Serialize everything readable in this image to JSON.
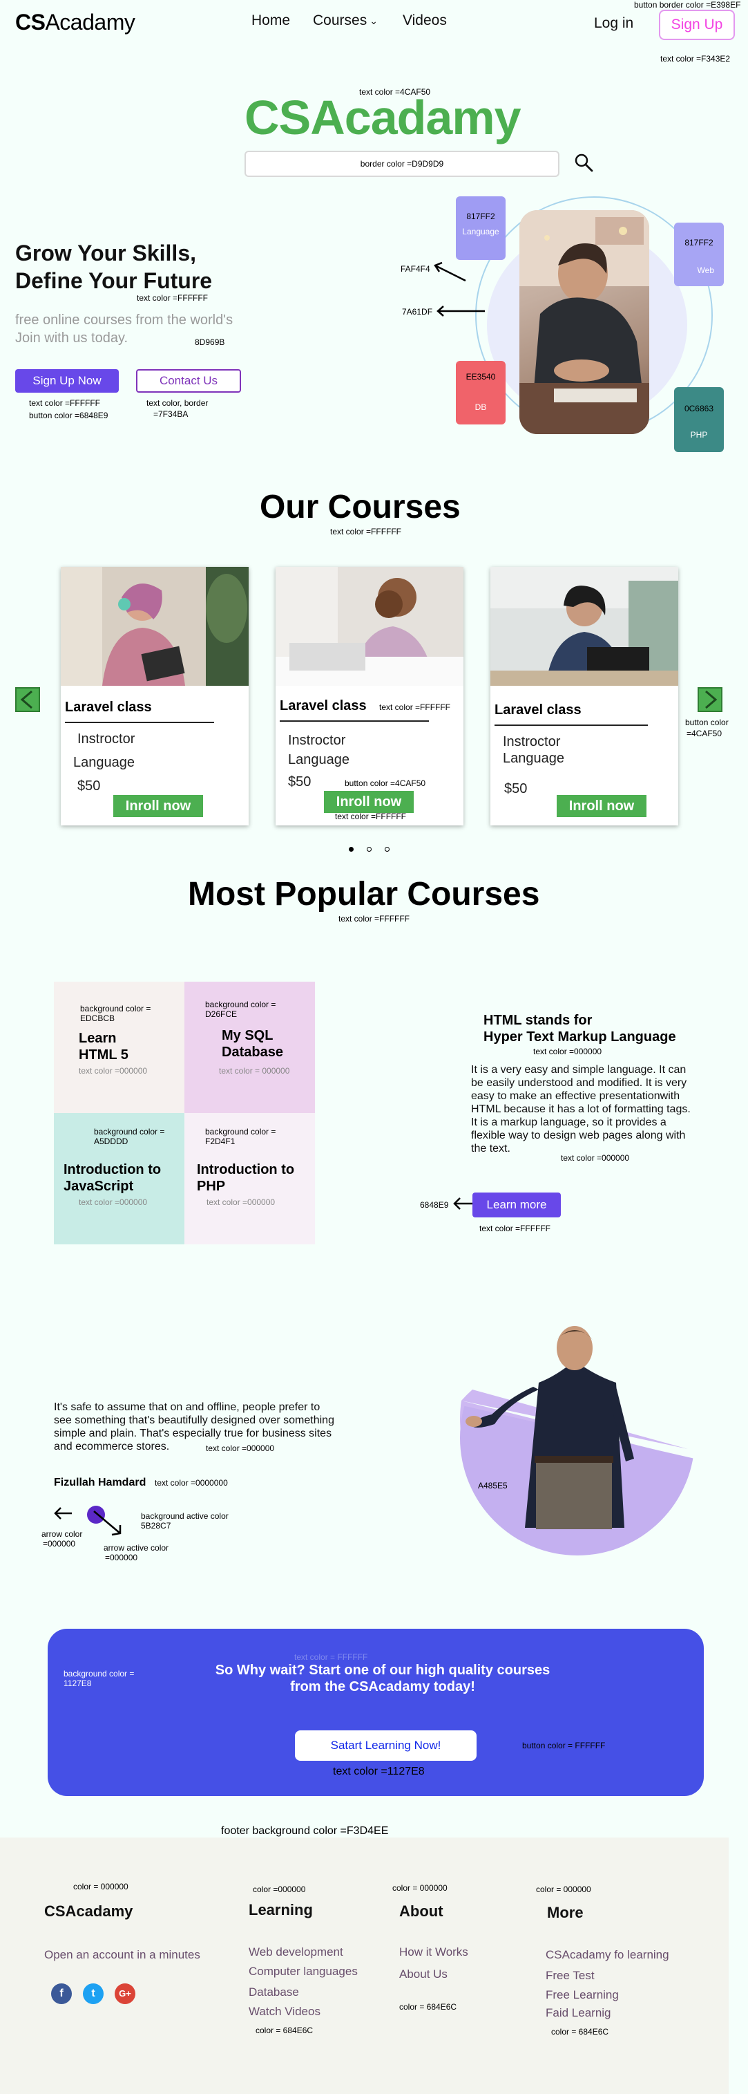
{
  "nav": {
    "logo_bold": "CS",
    "logo_rest": "Acadamy",
    "links": [
      "Home",
      "Courses",
      "Videos"
    ],
    "login": "Log in",
    "signup": "Sign Up",
    "note_border": "button border color =E398EF",
    "note_text": "text color =F343E2"
  },
  "hero": {
    "brand_note": "text color =4CAF50",
    "brand": "CSAcadamy",
    "search_placeholder": "border color =D9D9D9",
    "heading_line1": "Grow Your Skills,",
    "heading_line2": "Define Your Future",
    "heading_note": "text color =FFFFFF",
    "sub_line1": "free online courses from the world's",
    "sub_line2": "Join with us today.",
    "sub_note": "8D969B",
    "primary_btn": "Sign Up Now",
    "outline_btn": "Contact Us",
    "primary_note1": "text color =FFFFFF",
    "primary_note2": "button color =6848E9",
    "outline_note1": "text color, border",
    "outline_note2": "=7F34BA",
    "badges": [
      {
        "code": "817FF2",
        "label": "Language",
        "color": "#817FF2"
      },
      {
        "code": "817FF2",
        "label": "Web",
        "color": "#817FF2"
      },
      {
        "code": "EE3540",
        "label": "DB",
        "color": "#EE3540"
      },
      {
        "code": "0C6863",
        "label": "PHP",
        "color": "#0C6863"
      }
    ],
    "arrow_note1": "FAF4F4",
    "arrow_note2": "7A61DF"
  },
  "courses": {
    "title": "Our Courses",
    "title_note": "text color =FFFFFF",
    "cards": [
      {
        "title": "Laravel class",
        "instructor": "Instroctor",
        "language": "Language",
        "price": "$50",
        "enroll": "Inroll now"
      },
      {
        "title": "Laravel class",
        "instructor": "Instroctor",
        "language": "Language",
        "price": "$50",
        "enroll": "Inroll now"
      },
      {
        "title": "Laravel class",
        "instructor": "Instroctor",
        "language": "Language",
        "price": "$50",
        "enroll": "Inroll now"
      }
    ],
    "card2_title_note": "text color =FFFFFF",
    "card2_btn_note": "button color =4CAF50",
    "card2_enroll_note": "text color =FFFFFF",
    "right_arrow_note1": "button color",
    "right_arrow_note2": "=4CAF50",
    "accent": "#4CAF50"
  },
  "popular": {
    "title": "Most Popular Courses",
    "title_note": "text color =FFFFFF",
    "tiles": [
      {
        "note1": "background color =",
        "note2": "EDCBCB",
        "title1": "Learn",
        "title2": "HTML 5",
        "tnote": "text color =000000",
        "bg": "#F6F1EF"
      },
      {
        "note1": "background color =",
        "note2": "D26FCE",
        "title1": "My SQL",
        "title2": "Database",
        "tnote": "text color = 000000",
        "bg": "#EDD3EE"
      },
      {
        "note1": "background color =",
        "note2": "A5DDDD",
        "title1": "Introduction to",
        "title2": "JavaScript",
        "tnote": "text color =000000",
        "bg": "#C8ECE6"
      },
      {
        "note1": "background color =",
        "note2": "F2D4F1",
        "title1": "Introduction to",
        "title2": "PHP",
        "tnote": "text color =000000",
        "bg": "#F7F0F7"
      }
    ],
    "html_heading1": "HTML stands for",
    "html_heading2": "Hyper Text Markup Language",
    "html_heading_note": "text color =000000",
    "html_body": [
      "It is a very easy and simple language. It can",
      "be easily understood and modified. It is very",
      "easy to make an effective presentationwith",
      "HTML because it has a lot of formatting tags.",
      "It is a markup language, so it provides a",
      "flexible way to design web pages along with",
      "the text."
    ],
    "html_body_note": "text color =000000",
    "learn_more": "Learn more",
    "learn_more_note": "text color =FFFFFF",
    "learn_more_arrow_note": "6848E9"
  },
  "testimonial": {
    "quote": [
      "It's safe to assume that on and offline, people prefer to",
      " see something that's beautifully designed over something",
      "simple and plain. That's especially true for business sites",
      "and ecommerce stores."
    ],
    "quote_note": "text color =000000",
    "author": "Fizullah Hamdard",
    "author_note": "text color =0000000",
    "arrow_note1": "arrow color",
    "arrow_note2": "=000000",
    "active_note1": "arrow active color",
    "active_note2": "=000000",
    "bg_active_note1": "background active color",
    "bg_active_note2": "5B28C7",
    "circle_note": "A485E5"
  },
  "cta": {
    "title_note": "text color = FFFFFF",
    "bg_note1": "background color =",
    "bg_note2": "1127E8",
    "heading1": "So Why wait? Start one of our high quality courses",
    "heading2": "from the CSAcadamy today!",
    "button": "Satart Learning Now!",
    "button_note": "button color = FFFFFF",
    "btn_text_note": "text color =1127E8"
  },
  "footer": {
    "bg_note": "footer background color =F3D4EE",
    "col1_note": "color = 000000",
    "brand": "CSAcadamy",
    "tagline": "Open an account in a minutes",
    "col2_note": "color =000000",
    "learning": "Learning",
    "learning_links": [
      "Web development",
      "Computer languages",
      "Database",
      "Watch Videos"
    ],
    "learning_links_note": "color = 684E6C",
    "col3_note": "color = 000000",
    "about": "About",
    "about_links": [
      "How it Works",
      "About Us"
    ],
    "about_links_note": "color = 684E6C",
    "col4_note": "color = 000000",
    "more": "More",
    "more_links": [
      "CSAcadamy fo learning",
      "Free Test",
      "Free Learning",
      "Faid Learnig"
    ],
    "more_links_note": "color = 684E6C"
  }
}
